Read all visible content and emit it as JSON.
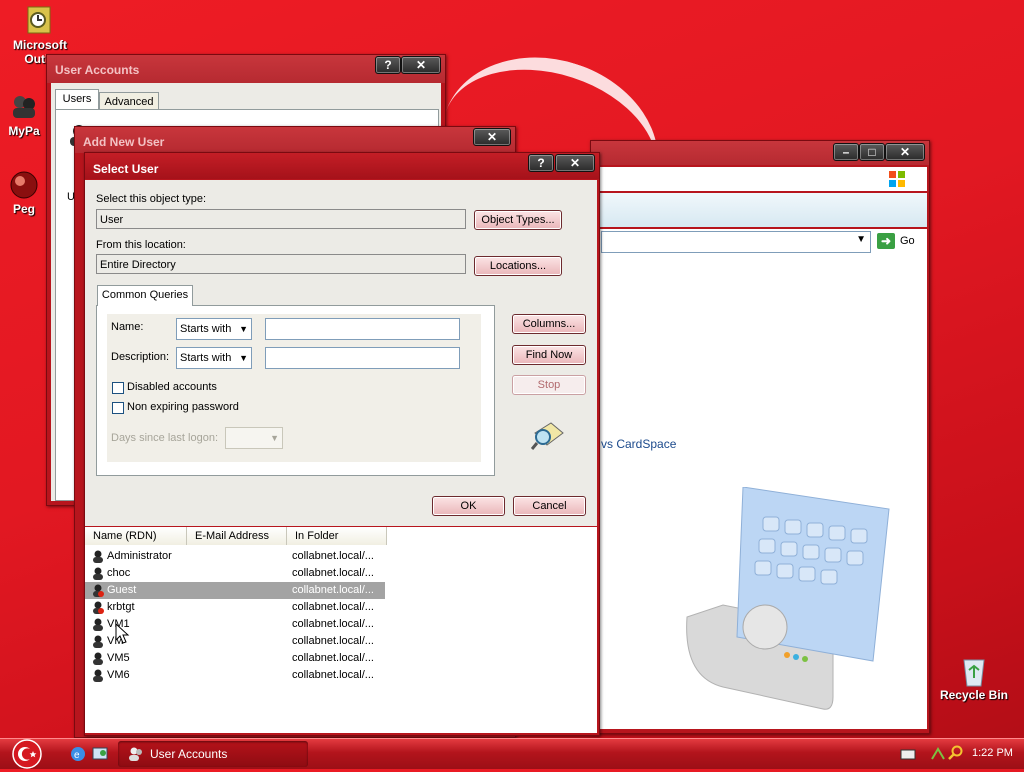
{
  "desktop": {
    "icons": [
      {
        "label_line1": "Microsoft",
        "label_line2": "Outlo",
        "icon": "outlook-icon"
      },
      {
        "label_line1": "MyPa",
        "icon": "users-icon"
      },
      {
        "label_line1": "Peg",
        "icon": "pegasus-icon"
      },
      {
        "label_line1": "Recycle Bin",
        "icon": "recycle-bin-icon"
      }
    ]
  },
  "user_accounts_window": {
    "title": "User Accounts",
    "tabs": [
      "Users",
      "Advanced"
    ],
    "partial_text": "U"
  },
  "background_window": {
    "go_label": "Go",
    "cardspace_text": "vs CardSpace"
  },
  "add_new_user_window": {
    "title": "Add New User"
  },
  "select_user_dialog": {
    "title": "Select User",
    "object_type_label": "Select this object type:",
    "object_type_value": "User",
    "object_types_button": "Object Types...",
    "location_label": "From this location:",
    "location_value": "Entire Directory",
    "locations_button": "Locations...",
    "common_queries_tab": "Common Queries",
    "name_label": "Name:",
    "name_mode": "Starts with",
    "name_value": "",
    "description_label": "Description:",
    "description_mode": "Starts with",
    "description_value": "",
    "disabled_accounts_label": "Disabled accounts",
    "non_expiring_label": "Non expiring password",
    "days_since_label": "Days since last logon:",
    "columns_button": "Columns...",
    "find_now_button": "Find Now",
    "stop_button": "Stop",
    "ok_button": "OK",
    "cancel_button": "Cancel",
    "results": {
      "columns": [
        "Name (RDN)",
        "E-Mail Address",
        "In Folder"
      ],
      "rows": [
        {
          "name": "Administrator",
          "email": "",
          "folder": "collabnet.local/...",
          "selected": false,
          "disabled": false
        },
        {
          "name": "choc",
          "email": "",
          "folder": "collabnet.local/...",
          "selected": false,
          "disabled": false
        },
        {
          "name": "Guest",
          "email": "",
          "folder": "collabnet.local/...",
          "selected": true,
          "disabled": true
        },
        {
          "name": "krbtgt",
          "email": "",
          "folder": "collabnet.local/...",
          "selected": false,
          "disabled": true
        },
        {
          "name": "VM1",
          "email": "",
          "folder": "collabnet.local/...",
          "selected": false,
          "disabled": false
        },
        {
          "name": "VM",
          "email": "",
          "folder": "collabnet.local/...",
          "selected": false,
          "disabled": false
        },
        {
          "name": "VM5",
          "email": "",
          "folder": "collabnet.local/...",
          "selected": false,
          "disabled": false
        },
        {
          "name": "VM6",
          "email": "",
          "folder": "collabnet.local/...",
          "selected": false,
          "disabled": false
        }
      ]
    }
  },
  "taskbar": {
    "task_label": "User Accounts",
    "clock": "1:22 PM"
  }
}
